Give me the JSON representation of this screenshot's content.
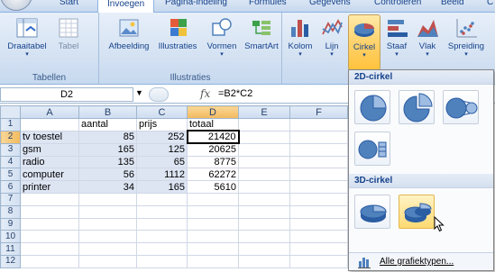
{
  "tabs": [
    "Start",
    "Invoegen",
    "Pagina-indeling",
    "Formules",
    "Gegevens",
    "Controleren",
    "Beeld",
    "C"
  ],
  "ribbon": {
    "groups": {
      "tables": "Tabellen",
      "illustrations": "Illustraties"
    },
    "buttons": {
      "pivot": "Draaitabel",
      "table": "Tabel",
      "picture": "Afbeelding",
      "clipart": "Illustraties",
      "shapes": "Vormen",
      "smartart": "SmartArt",
      "column": "Kolom",
      "line": "Lijn",
      "pie": "Cirkel",
      "bar": "Staaf",
      "area": "Vlak",
      "scatter": "Spreiding"
    }
  },
  "formula_bar": {
    "name_box": "D2",
    "fx": "fx",
    "formula": "=B2*C2"
  },
  "sheet": {
    "columns": [
      "A",
      "B",
      "C",
      "D",
      "E",
      "F"
    ],
    "rows": [
      [
        "",
        "aantal",
        "prijs",
        "totaal",
        "",
        ""
      ],
      [
        "tv toestel",
        "85",
        "252",
        "21420",
        "",
        ""
      ],
      [
        "gsm",
        "165",
        "125",
        "20625",
        "",
        ""
      ],
      [
        "radio",
        "135",
        "65",
        "8775",
        "",
        ""
      ],
      [
        "computer",
        "56",
        "1112",
        "62272",
        "",
        ""
      ],
      [
        "printer",
        "34",
        "165",
        "5610",
        "",
        ""
      ],
      [
        "",
        "",
        "",
        "",
        "",
        ""
      ],
      [
        "",
        "",
        "",
        "",
        "",
        ""
      ],
      [
        "",
        "",
        "",
        "",
        "",
        ""
      ],
      [
        "",
        "",
        "",
        "",
        "",
        ""
      ],
      [
        "",
        "",
        "",
        "",
        "",
        ""
      ],
      [
        "",
        "",
        "",
        "",
        "",
        ""
      ]
    ],
    "row_numbers": [
      "1",
      "2",
      "3",
      "4",
      "5",
      "6",
      "7",
      "8",
      "9",
      "10",
      "11",
      "12"
    ]
  },
  "pie_menu": {
    "section_2d": "2D-cirkel",
    "section_3d": "3D-cirkel",
    "all_types": "Alle grafiektypen..."
  },
  "colors": {
    "accent": "#15428b",
    "pie_blue": "#4f81bd",
    "selection": "#ffd36e"
  }
}
